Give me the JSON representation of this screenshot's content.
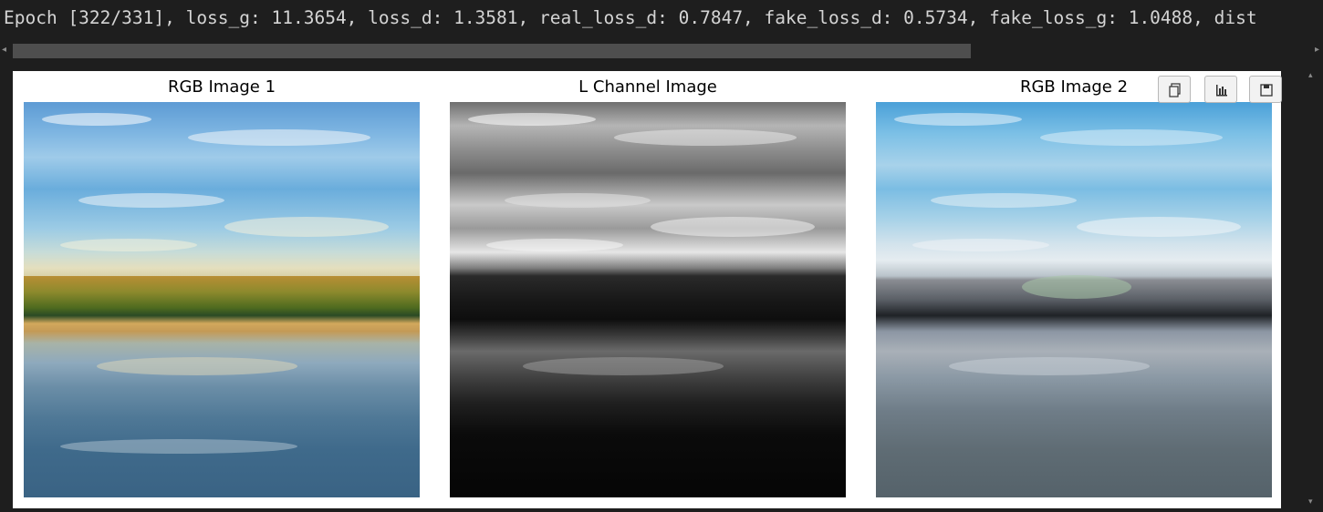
{
  "output": {
    "log_line": "Epoch [322/331], loss_g: 11.3654, loss_d: 1.3581, real_loss_d: 0.7847, fake_loss_d: 0.5734, fake_loss_g: 1.0488, dist"
  },
  "figure": {
    "panels": [
      {
        "title": "RGB Image 1"
      },
      {
        "title": "L Channel Image"
      },
      {
        "title": "RGB Image 2"
      }
    ],
    "toolbar": {
      "icons": [
        "copy-icon",
        "bar-chart-icon",
        "save-icon"
      ]
    }
  },
  "colors": {
    "background": "#1e1e1e",
    "log_text": "#d4d4d4",
    "figure_background": "#ffffff",
    "scrollbar_thumb": "#4e4e4e"
  }
}
